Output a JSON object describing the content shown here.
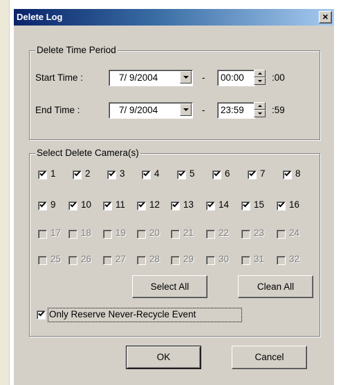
{
  "dialog": {
    "title": "Delete Log",
    "close_label": "×"
  },
  "time_period": {
    "legend": "Delete Time Period",
    "start_label": "Start Time :",
    "start_date": "7/ 9/2004",
    "start_time": "00:00",
    "start_seconds": ":00",
    "end_label": "End Time :",
    "end_date": "7/ 9/2004",
    "end_time": "23:59",
    "end_seconds": ":59",
    "separator": "-"
  },
  "cameras": {
    "legend": "Select Delete Camera(s)",
    "items": [
      {
        "label": "1",
        "checked": true,
        "enabled": true
      },
      {
        "label": "2",
        "checked": true,
        "enabled": true
      },
      {
        "label": "3",
        "checked": true,
        "enabled": true
      },
      {
        "label": "4",
        "checked": true,
        "enabled": true
      },
      {
        "label": "5",
        "checked": true,
        "enabled": true
      },
      {
        "label": "6",
        "checked": true,
        "enabled": true
      },
      {
        "label": "7",
        "checked": true,
        "enabled": true
      },
      {
        "label": "8",
        "checked": true,
        "enabled": true
      },
      {
        "label": "9",
        "checked": true,
        "enabled": true
      },
      {
        "label": "10",
        "checked": true,
        "enabled": true
      },
      {
        "label": "11",
        "checked": true,
        "enabled": true
      },
      {
        "label": "12",
        "checked": true,
        "enabled": true
      },
      {
        "label": "13",
        "checked": true,
        "enabled": true
      },
      {
        "label": "14",
        "checked": true,
        "enabled": true
      },
      {
        "label": "15",
        "checked": true,
        "enabled": true
      },
      {
        "label": "16",
        "checked": true,
        "enabled": true
      },
      {
        "label": "17",
        "checked": false,
        "enabled": false
      },
      {
        "label": "18",
        "checked": false,
        "enabled": false
      },
      {
        "label": "19",
        "checked": false,
        "enabled": false
      },
      {
        "label": "20",
        "checked": false,
        "enabled": false
      },
      {
        "label": "21",
        "checked": false,
        "enabled": false
      },
      {
        "label": "22",
        "checked": false,
        "enabled": false
      },
      {
        "label": "23",
        "checked": false,
        "enabled": false
      },
      {
        "label": "24",
        "checked": false,
        "enabled": false
      },
      {
        "label": "25",
        "checked": false,
        "enabled": false
      },
      {
        "label": "26",
        "checked": false,
        "enabled": false
      },
      {
        "label": "27",
        "checked": false,
        "enabled": false
      },
      {
        "label": "28",
        "checked": false,
        "enabled": false
      },
      {
        "label": "29",
        "checked": false,
        "enabled": false
      },
      {
        "label": "30",
        "checked": false,
        "enabled": false
      },
      {
        "label": "31",
        "checked": false,
        "enabled": false
      },
      {
        "label": "32",
        "checked": false,
        "enabled": false
      }
    ],
    "select_all_label": "Select All",
    "clean_all_label": "Clean All",
    "reserve_label": "Only Reserve Never-Recycle Event",
    "reserve_checked": true
  },
  "footer": {
    "ok_label": "OK",
    "cancel_label": "Cancel"
  },
  "icons": {
    "dropdown": "chevron-down-icon",
    "spin_up": "arrow-up-icon",
    "spin_down": "arrow-down-icon",
    "check": "checkmark-icon"
  }
}
